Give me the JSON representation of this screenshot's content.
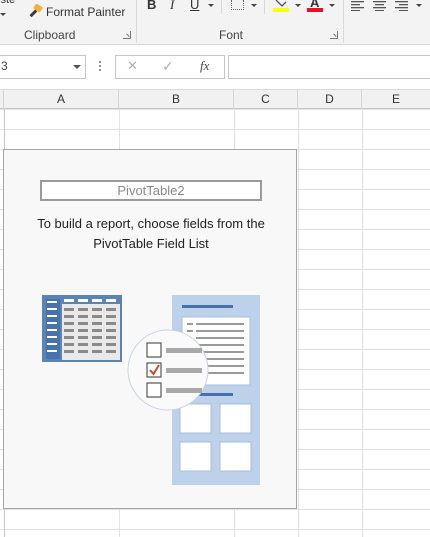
{
  "ribbon": {
    "paste_fragment": "iste",
    "format_painter_label": "Format Painter",
    "groups": {
      "clipboard_label": "Clipboard",
      "font_label": "Font"
    },
    "font_buttons": {
      "bold": "B",
      "italic": "I",
      "underline": "U",
      "font_color": "A"
    },
    "colors": {
      "highlight": "#ffff00",
      "font_color": "#e81123"
    }
  },
  "formula_bar": {
    "name_box_value": "3",
    "cancel_glyph": "✕",
    "enter_glyph": "✓",
    "fx_label": "fx",
    "formula_value": ""
  },
  "columns": [
    "A",
    "B",
    "C",
    "D",
    "E"
  ],
  "pivot": {
    "name": "PivotTable2",
    "message": "To build a report, choose fields from the PivotTable Field List"
  }
}
